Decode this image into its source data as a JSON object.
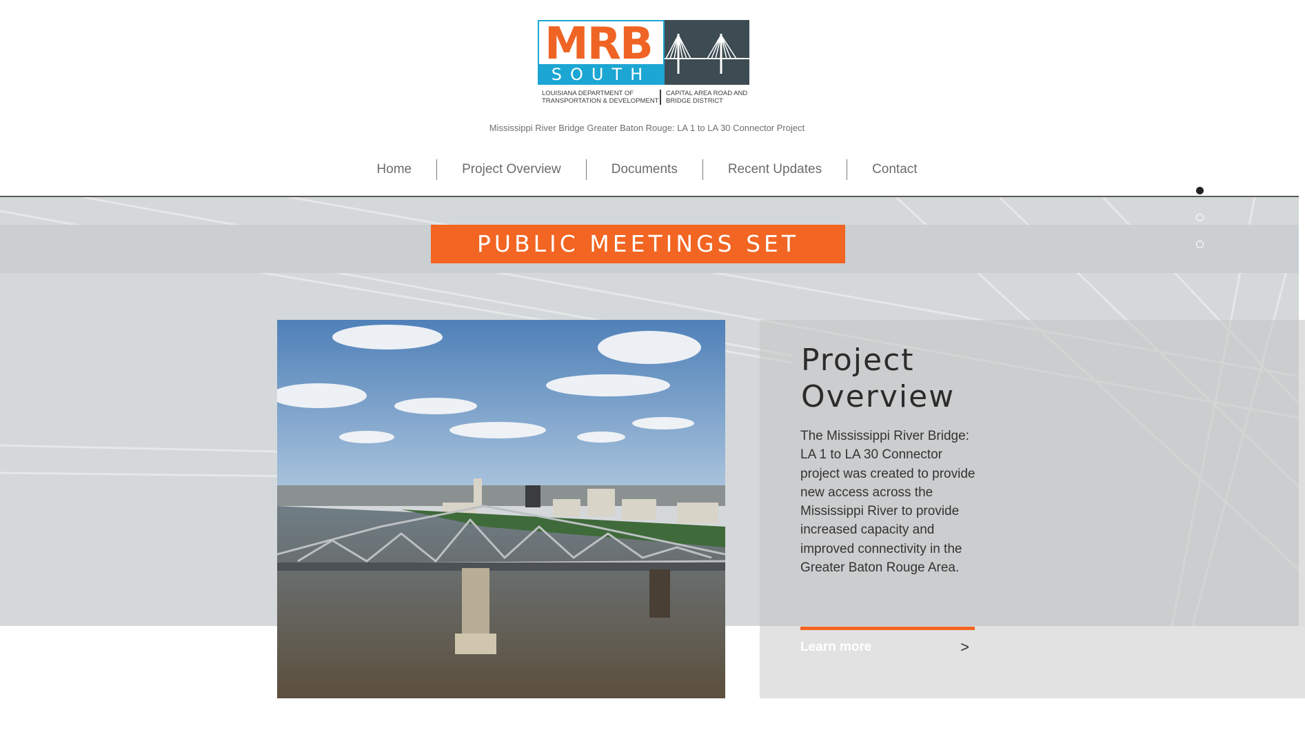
{
  "header": {
    "logo": {
      "mrb": "MRB",
      "south": "SOUTH",
      "dotd": "LOUISIANA DEPARTMENT OF TRANSPORTATION & DEVELOPMENT",
      "crb": "CAPITAL AREA ROAD AND BRIDGE DISTRICT"
    },
    "tagline": "Mississippi River Bridge Greater Baton Rouge: LA 1 to LA 30 Connector Project"
  },
  "nav": {
    "items": [
      {
        "label": "Home"
      },
      {
        "label": "Project Overview"
      },
      {
        "label": "Documents"
      },
      {
        "label": "Recent Updates"
      },
      {
        "label": "Contact"
      }
    ]
  },
  "banner": {
    "label": "PUBLIC MEETINGS SET"
  },
  "slideshow": {
    "count": 3,
    "active_index": 0
  },
  "overview": {
    "title": "Project Overview",
    "body": "The Mississippi River Bridge: LA 1 to LA 30 Connector project was created to provide new access across the Mississippi River to provide increased capacity and improved connectivity in the Greater Baton Rouge Area.",
    "learn_more": "Learn more",
    "arrow": ">"
  },
  "colors": {
    "accent": "#f26522",
    "logo_blue": "#1ba6d3",
    "logo_slate": "#3d4b52"
  }
}
